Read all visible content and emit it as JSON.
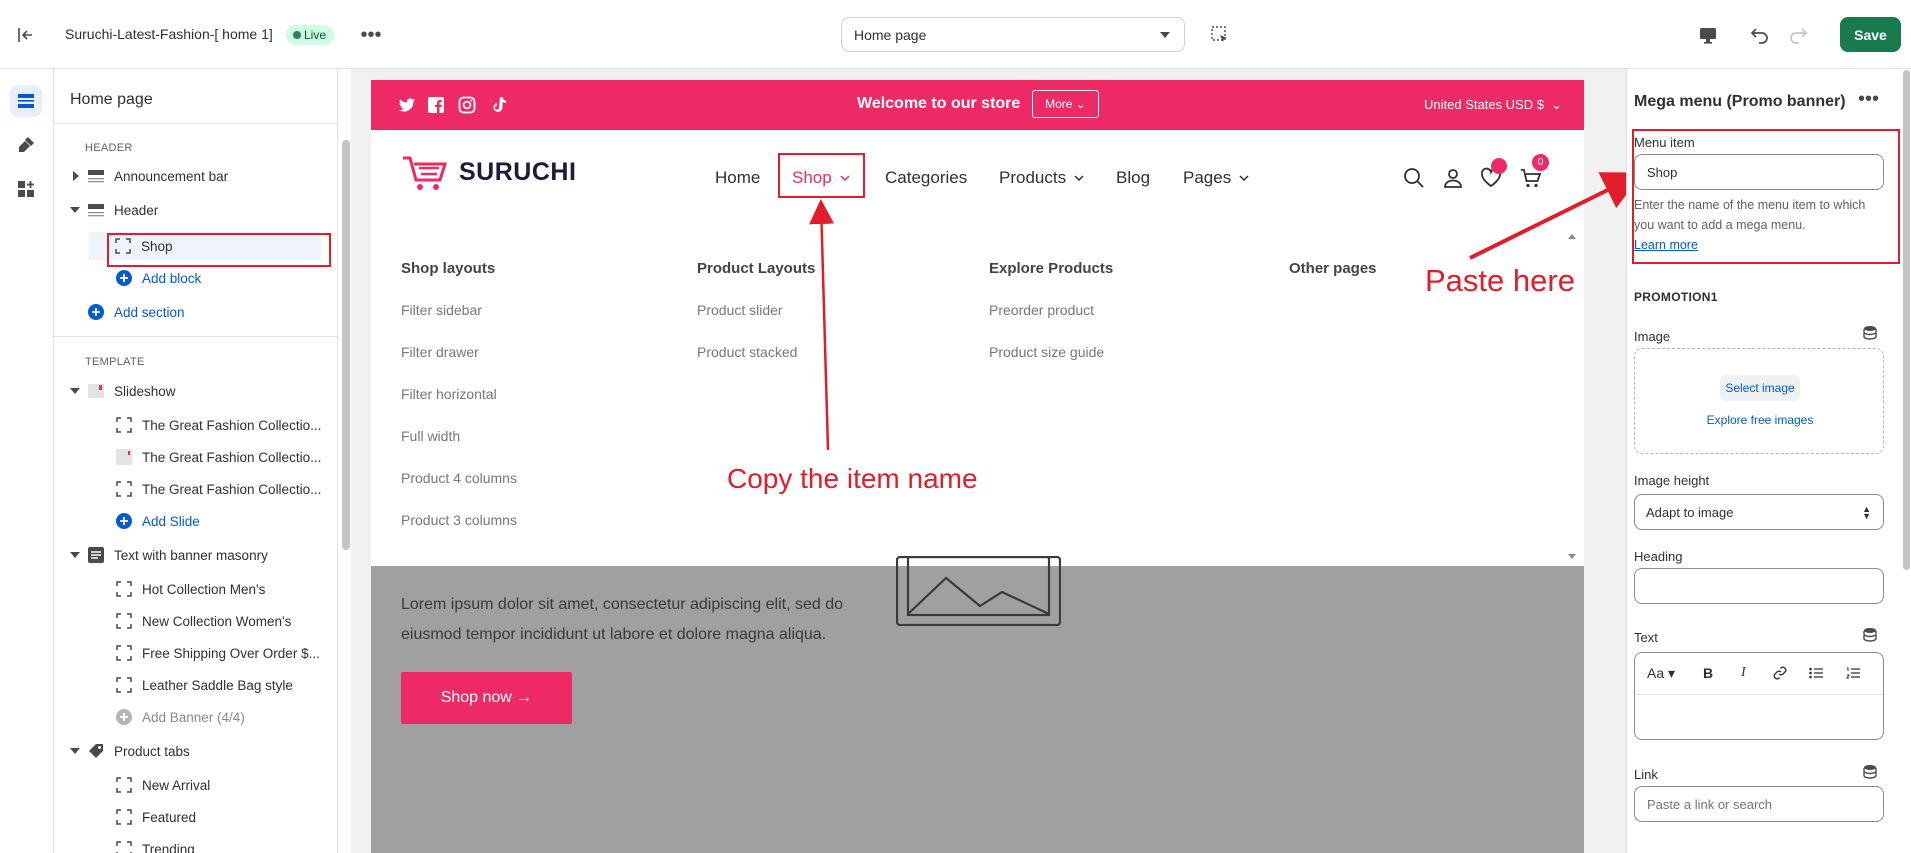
{
  "topbar": {
    "store_name": "Suruchi-Latest-Fashion-[ home 1]",
    "live_badge": "Live",
    "page_selector": "Home page",
    "save_label": "Save"
  },
  "sidebar": {
    "title": "Home page",
    "header_caption": "HEADER",
    "announcement_bar": "Announcement bar",
    "header": "Header",
    "shop_block": "Shop",
    "add_block": "Add block",
    "add_section": "Add section",
    "template_caption": "TEMPLATE",
    "slideshow": "Slideshow",
    "slides": [
      "The Great Fashion Collectio...",
      "The Great Fashion Collectio...",
      "The Great Fashion Collectio..."
    ],
    "add_slide": "Add Slide",
    "text_banner": "Text with banner masonry",
    "banners": [
      "Hot Collection Men's",
      "New Collection Women's",
      "Free Shipping Over Order $...",
      "Leather Saddle Bag style"
    ],
    "add_banner": "Add Banner (4/4)",
    "product_tabs": "Product tabs",
    "tabs": [
      "New Arrival",
      "Featured",
      "Trending"
    ]
  },
  "preview": {
    "welcome": "Welcome to our store",
    "more_label": "More",
    "currency": "United States USD $",
    "logo_text": "SURUCHI",
    "cart_count": "0",
    "nav": [
      "Home",
      "Shop",
      "Categories",
      "Products",
      "Blog",
      "Pages"
    ],
    "mega": {
      "columns": [
        {
          "title": "Shop layouts",
          "links": [
            "Filter sidebar",
            "Filter drawer",
            "Filter horizontal",
            "Full width",
            "Product 4 columns",
            "Product 3 columns"
          ]
        },
        {
          "title": "Product Layouts",
          "links": [
            "Product slider",
            "Product stacked"
          ]
        },
        {
          "title": "Explore Products",
          "links": [
            "Preorder product",
            "Product size guide"
          ]
        },
        {
          "title": "Other pages",
          "links": []
        }
      ]
    },
    "lorem": "Lorem ipsum dolor sit amet, consectetur adipiscing elit, sed do eiusmod tempor incididunt ut labore et dolore magna aliqua.",
    "shop_now": "Shop now"
  },
  "annotations": {
    "copy": "Copy the item name",
    "paste": "Paste here"
  },
  "right_panel": {
    "title": "Mega menu (Promo banner)",
    "menu_item_label": "Menu item",
    "menu_item_value": "Shop",
    "help_text": "Enter the name of the menu item to which you want to add a mega menu.",
    "learn_more": "Learn more",
    "promotion_caption": "PROMOTION1",
    "image_label": "Image",
    "select_image": "Select image",
    "explore_free": "Explore free images",
    "image_height_label": "Image height",
    "image_height_value": "Adapt to image",
    "heading_label": "Heading",
    "heading_value": "",
    "text_label": "Text",
    "link_label": "Link",
    "link_placeholder": "Paste a link or search"
  },
  "colors": {
    "accent_pink": "#ed2a65",
    "save_green": "#1a7a4f",
    "annotation_red": "#e11d2a",
    "link_blue": "#005bd3"
  }
}
